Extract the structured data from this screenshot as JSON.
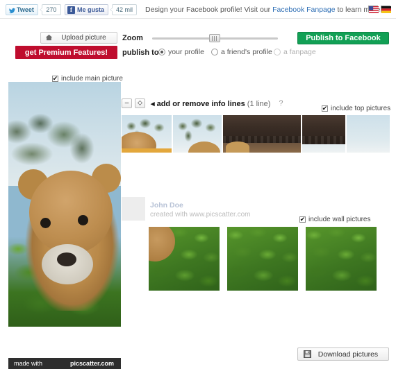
{
  "topbar": {
    "tweet": {
      "label": "Tweet",
      "count": "270",
      "icon": "twitter-bird-icon"
    },
    "facebook": {
      "label": "Me gusta",
      "count": "42 mil",
      "icon": "facebook-f-icon"
    },
    "promo": {
      "before": "Design your Facebook profile! Visit our ",
      "link": "Facebook Fanpage",
      "after": " to learn more."
    },
    "flags": [
      {
        "name": "flag-us",
        "title": "English"
      },
      {
        "name": "flag-de",
        "title": "Deutsch"
      }
    ]
  },
  "controls": {
    "upload_label": "Upload picture",
    "upload_icon": "upload-home-icon",
    "premium_label": "get Premium Features!",
    "premium_color": "#bf0d2e",
    "zoom_label": "Zoom",
    "zoom_value": 45,
    "publish_button": "Publish to Facebook",
    "publish_button_color": "#12a055",
    "publish_to_label": "publish to",
    "publish_options": [
      {
        "label": "your profile",
        "selected": true,
        "disabled": false
      },
      {
        "label": "a friend's profile",
        "selected": false,
        "disabled": false
      },
      {
        "label": "a fanpage",
        "selected": false,
        "disabled": true
      }
    ]
  },
  "main_picture": {
    "checkbox_label": "include main picture",
    "checked": true,
    "check_glyph": "✔",
    "watermark_left": "made with",
    "watermark_right": "picscatter.com"
  },
  "info_lines": {
    "minus_label": "–",
    "plus_label": "⬦",
    "arrow": "◂",
    "text": "add or remove info lines",
    "count": "(1 line)",
    "help_icon": "question-mark-icon",
    "help_glyph": "?"
  },
  "top_pictures": {
    "checkbox_label": "include top pictures",
    "checked": true,
    "check_glyph": "✔",
    "thumbnails": [
      {
        "name": "top-thumb-1"
      },
      {
        "name": "top-thumb-2"
      },
      {
        "name": "top-thumb-3"
      },
      {
        "name": "top-thumb-4"
      },
      {
        "name": "top-thumb-5"
      }
    ]
  },
  "profile": {
    "name": "John Doe",
    "subtitle": "created with www.picscatter.com"
  },
  "wall_pictures": {
    "checkbox_label": "include wall pictures",
    "checked": true,
    "check_glyph": "✔",
    "pictures": [
      {
        "name": "wall-picture-1"
      },
      {
        "name": "wall-picture-2"
      },
      {
        "name": "wall-picture-3"
      }
    ]
  },
  "footer": {
    "download_label": "Download pictures",
    "download_icon": "floppy-save-icon"
  }
}
